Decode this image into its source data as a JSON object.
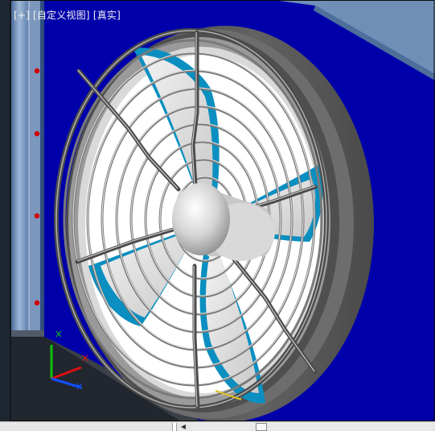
{
  "viewport": {
    "label_parts": [
      "[+]",
      "[自定义视图]",
      "[真实]"
    ],
    "background_color": "#0000aa",
    "model": "axial-fan-with-wire-guard"
  },
  "ucs_axes": [
    "x-axis",
    "y-axis",
    "z-axis"
  ],
  "colors": {
    "viewport_bg": "#0000aa",
    "housing": "#5a5a5a",
    "blade_shadow": "#0a8fc0",
    "wall_panel": "#6f8fb6",
    "axis_x": "#e01010",
    "axis_y": "#10c010",
    "axis_z": "#1050ff"
  },
  "scrollbar": {
    "left_arrow_icon": "arrow-left-icon"
  }
}
